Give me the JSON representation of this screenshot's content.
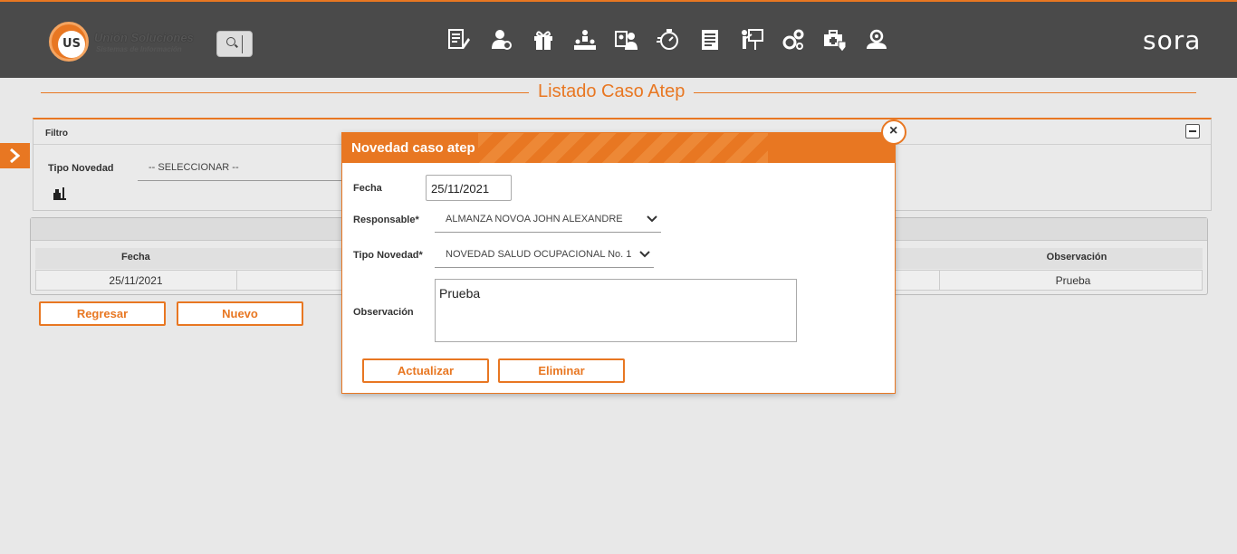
{
  "header": {
    "logo_badge": "US",
    "logo_line1": "Unión Soluciones",
    "logo_line2": "Sistemas de Información",
    "brand": "sora",
    "nav_icons": [
      "edit-document-icon",
      "user-badge-icon",
      "gift-icon",
      "org-chart-icon",
      "user-id-card-icon",
      "stopwatch-icon",
      "report-icon",
      "presentation-icon",
      "gears-icon",
      "medical-kit-icon",
      "support-person-icon"
    ]
  },
  "page": {
    "title": "Listado Caso Atep"
  },
  "filter": {
    "title": "Filtro",
    "tipo_novedad_label": "Tipo Novedad",
    "tipo_novedad_value": "-- SELECCIONAR --"
  },
  "table": {
    "columns": [
      "Fecha",
      "Observación"
    ],
    "rows": [
      {
        "fecha": "25/11/2021",
        "observacion": "Prueba"
      }
    ]
  },
  "actions": {
    "regresar": "Regresar",
    "nuevo": "Nuevo"
  },
  "modal": {
    "title": "Novedad caso atep",
    "fecha_label": "Fecha",
    "fecha_value": "25/11/2021",
    "responsable_label": "Responsable*",
    "responsable_value": "ALMANZA NOVOA JOHN ALEXANDRE",
    "tipo_label": "Tipo Novedad*",
    "tipo_value": "NOVEDAD SALUD OCUPACIONAL No. 1",
    "observacion_label": "Observación",
    "observacion_value": "Prueba",
    "actualizar": "Actualizar",
    "eliminar": "Eliminar",
    "close_symbol": "×"
  },
  "colors": {
    "accent": "#e87722",
    "topbar": "#4a4a4a",
    "background": "#e8e8e8"
  }
}
